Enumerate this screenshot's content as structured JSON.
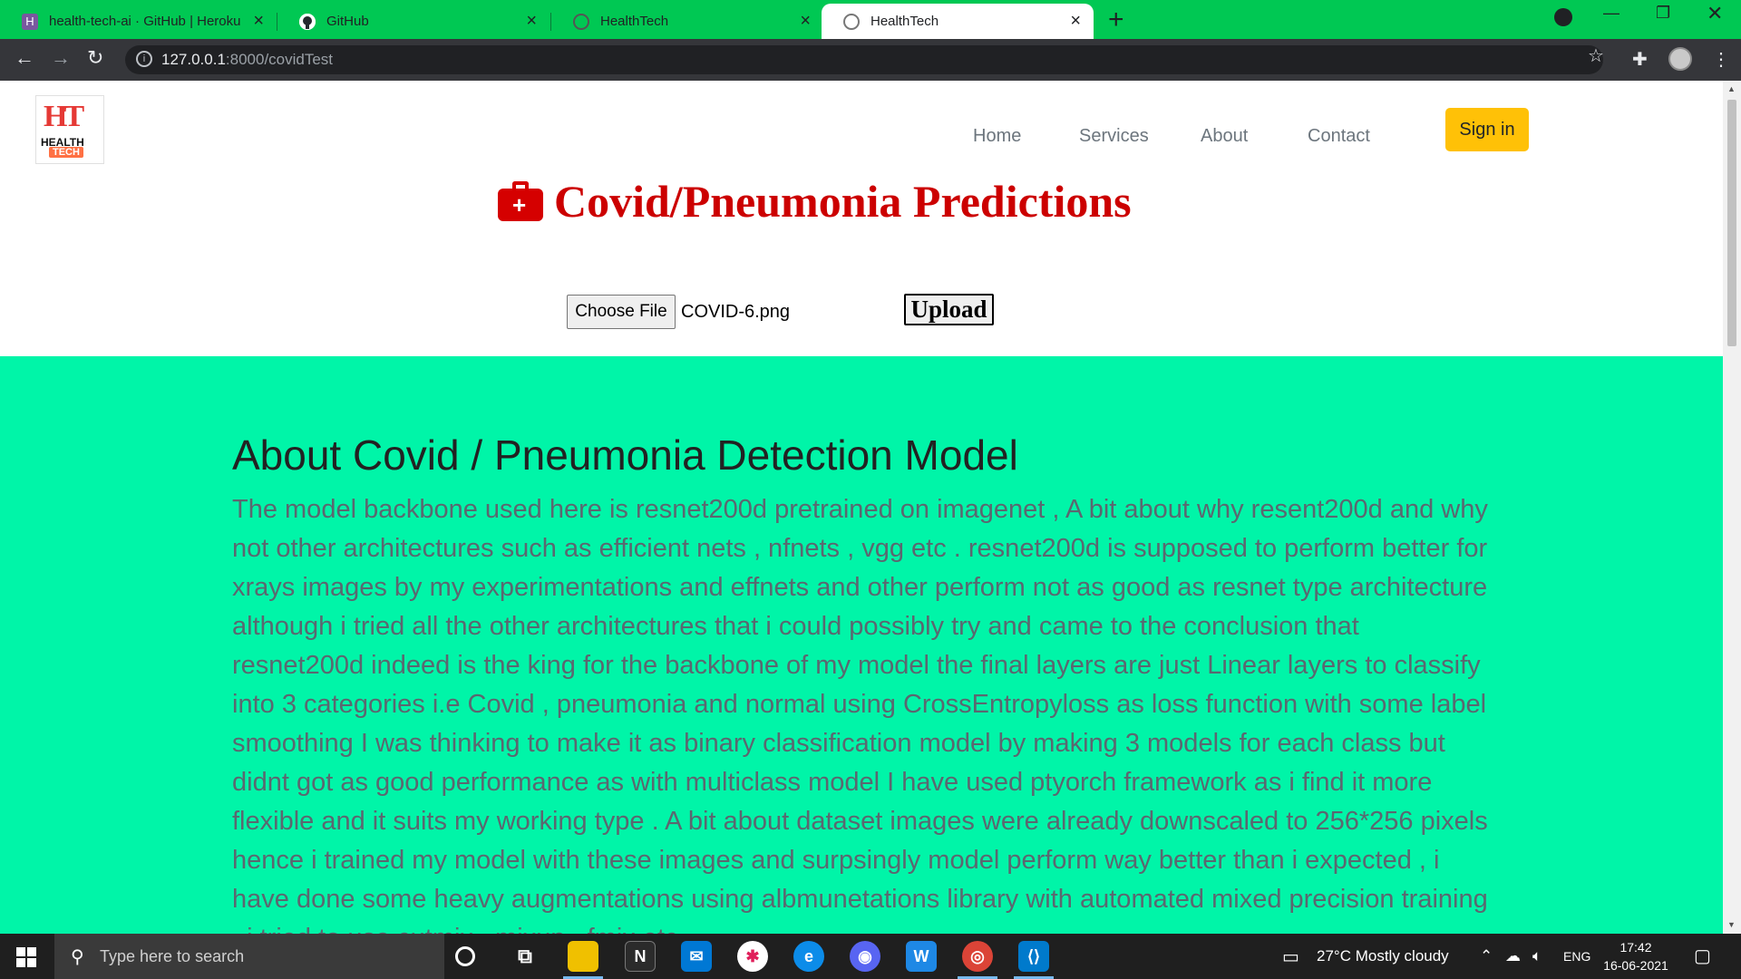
{
  "browser": {
    "tabs": [
      {
        "title": "health-tech-ai · GitHub | Heroku",
        "active": false,
        "favicon": "heroku-icon"
      },
      {
        "title": "GitHub",
        "active": false,
        "favicon": "github-icon"
      },
      {
        "title": "HealthTech",
        "active": false,
        "favicon": "globe-icon"
      },
      {
        "title": "HealthTech",
        "active": true,
        "favicon": "globe-icon"
      }
    ],
    "url_host": "127.0.0.1",
    "url_path": ":8000/covidTest"
  },
  "logo": {
    "line1": "HT",
    "line2": "HEALTH",
    "line3": "TECH"
  },
  "nav": {
    "items": [
      "Home",
      "Services",
      "About",
      "Contact"
    ],
    "signin": "Sign in"
  },
  "page": {
    "title": "Covid/Pneumonia Predictions",
    "choose_file": "Choose File",
    "file_name": "COVID-6.png",
    "upload": "Upload"
  },
  "about": {
    "heading": "About Covid / Pneumonia Detection Model",
    "body": "The model backbone used here is resnet200d pretrained on imagenet , A bit about why resent200d and why not other architectures such as efficient nets , nfnets , vgg etc . resnet200d is supposed to perform better for xrays images by my experimentations and effnets and other perform not as good as resnet type architecture although i tried all the other architectures that i could possibly try and came to the conclusion that resnet200d indeed is the king for the backbone of my model the final layers are just Linear layers to classify into 3 categories i.e Covid , pneumonia and normal using CrossEntropyloss as loss function with some label smoothing I was thinking to make it as binary classification model by making 3 models for each class but didnt got as good performance as with multiclass model I have used ptyorch framework as i find it more flexible and it suits my working type . A bit about dataset images were already downscaled to 256*256 pixels hence i trained my model with these images and surpsingly model perform way better than i expected , i have done some heavy augmentations using albmunetations library with automated mixed precision training , i tried to use cutmix , mixup , fmix etc"
  },
  "taskbar": {
    "search_placeholder": "Type here to search",
    "weather": "27°C  Mostly cloudy",
    "lang": "ENG",
    "time": "17:42",
    "date": "16-06-2021"
  },
  "colors": {
    "tabbar": "#00c853",
    "title_red": "#cc0000",
    "about_bg": "#00f5a8",
    "signin_yellow": "#ffc107"
  }
}
